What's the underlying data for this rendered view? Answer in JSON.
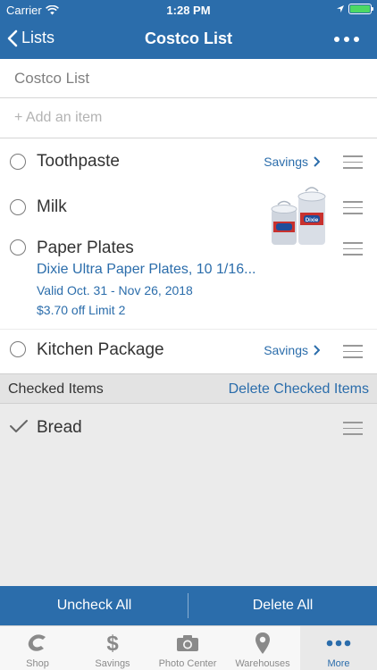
{
  "status": {
    "carrier": "Carrier",
    "time": "1:28 PM"
  },
  "nav": {
    "back_label": "Lists",
    "title": "Costco List"
  },
  "list": {
    "name": "Costco List",
    "add_placeholder": "+ Add an item",
    "items": [
      {
        "label": "Toothpaste",
        "savings": "Savings"
      },
      {
        "label": "Milk"
      },
      {
        "label": "Paper Plates",
        "deal_title": "Dixie Ultra Paper Plates, 10 1/16...",
        "deal_valid": "Valid Oct. 31 - Nov 26, 2018",
        "deal_offer": "$3.70 off Limit 2",
        "image_brand": "Dixie"
      },
      {
        "label": "Kitchen Package",
        "savings": "Savings"
      }
    ]
  },
  "checked": {
    "header": "Checked Items",
    "delete_label": "Delete Checked Items",
    "items": [
      {
        "label": "Bread"
      }
    ]
  },
  "actions": {
    "uncheck_all": "Uncheck All",
    "delete_all": "Delete All"
  },
  "tabs": [
    {
      "label": "Shop",
      "icon": "costco-c-icon"
    },
    {
      "label": "Savings",
      "icon": "dollar-icon"
    },
    {
      "label": "Photo Center",
      "icon": "camera-icon"
    },
    {
      "label": "Warehouses",
      "icon": "location-pin-icon"
    },
    {
      "label": "More",
      "icon": "more-dots-icon",
      "active": true
    }
  ],
  "colors": {
    "accent": "#2b6dab",
    "battery": "#4cd964"
  }
}
